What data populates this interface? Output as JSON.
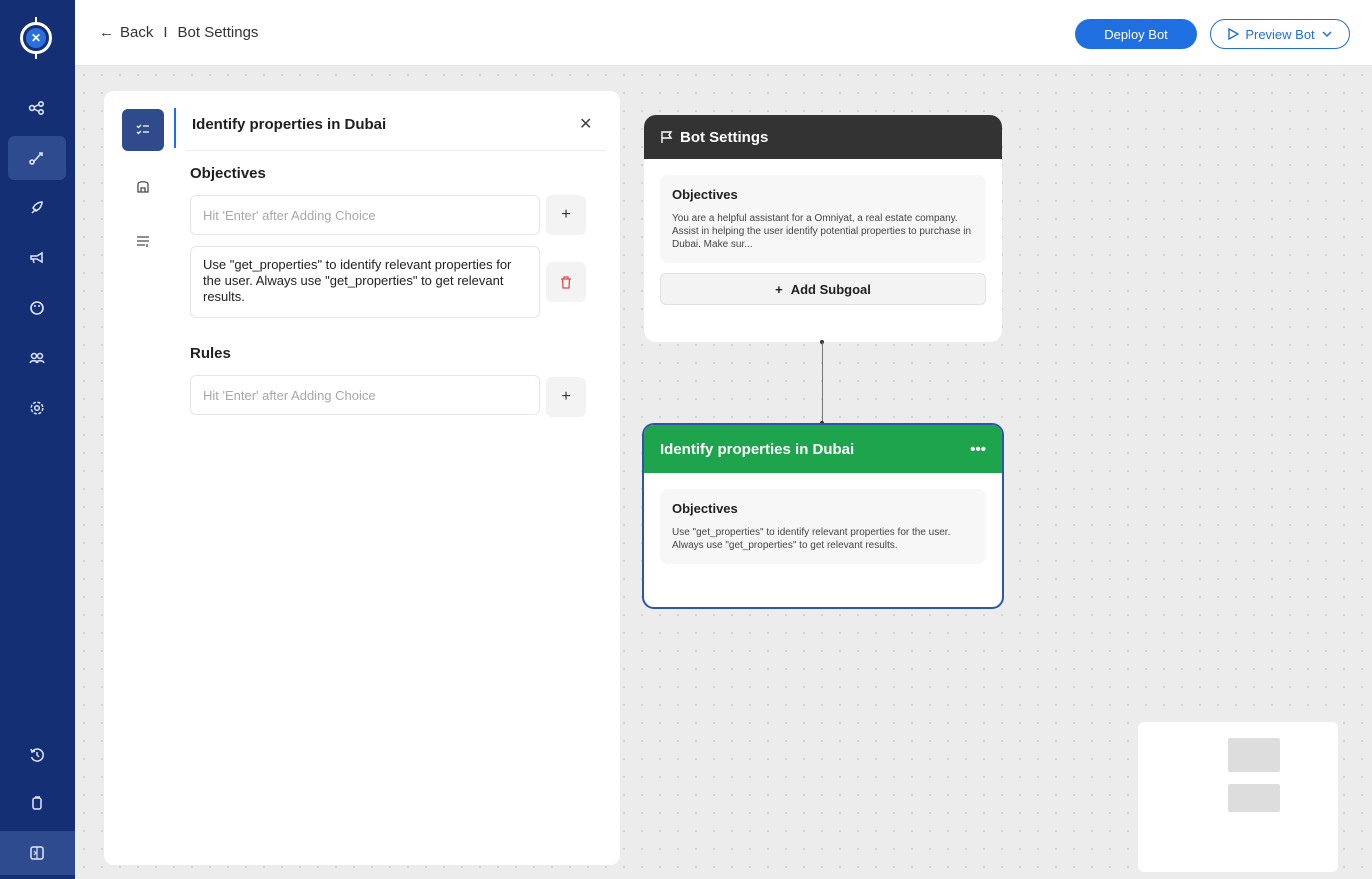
{
  "topbar": {
    "back_label": "Back",
    "divider": "I",
    "page_title": "Bot Settings",
    "deploy_label": "Deploy Bot",
    "preview_label": "Preview Bot"
  },
  "sidebar": {
    "items": [
      {
        "icon": "nodes-icon",
        "active": false
      },
      {
        "icon": "flow-icon",
        "active": true
      },
      {
        "icon": "rocket-icon",
        "active": false
      },
      {
        "icon": "megaphone-icon",
        "active": false
      },
      {
        "icon": "palette-icon",
        "active": false
      },
      {
        "icon": "people-icon",
        "active": false
      },
      {
        "icon": "settings-icon",
        "active": false
      },
      {
        "icon": "history-icon",
        "active": false
      },
      {
        "icon": "copy-icon",
        "active": false
      },
      {
        "icon": "collapse-panel-icon",
        "active": true
      }
    ]
  },
  "panel": {
    "title": "Identify properties in Dubai",
    "objectives_title": "Objectives",
    "objectives_placeholder": "Hit 'Enter' after Adding Choice",
    "objective_item": "Use \"get_properties\" to identify relevant properties for the user. Always use \"get_properties\" to get relevant results.",
    "rules_title": "Rules",
    "rules_placeholder": "Hit 'Enter' after Adding Choice"
  },
  "nodes": {
    "settings": {
      "title": "Bot Settings",
      "objectives_title": "Objectives",
      "objectives_text": "You are a helpful assistant for a Omniyat, a real estate company. Assist in helping the user identify potential properties to purchase in Dubai. Make sur...",
      "add_subgoal": "Add Subgoal"
    },
    "subgoal": {
      "title": "Identify properties in Dubai",
      "menu": "•••",
      "objectives_title": "Objectives",
      "objectives_text": "Use \"get_properties\" to identify relevant properties for the user. Always use \"get_properties\" to get relevant results."
    }
  },
  "colors": {
    "sidebar": "#142f73",
    "accent": "#1f6fe0",
    "green": "#1ea44c",
    "dark_header": "#333333"
  }
}
